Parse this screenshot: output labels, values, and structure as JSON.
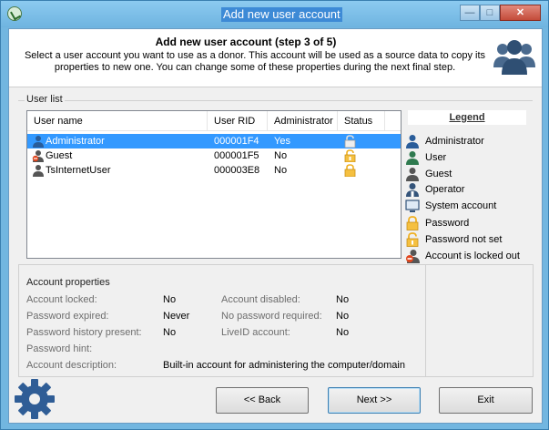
{
  "window": {
    "title": "Add new user account",
    "controls": {
      "minimize": "—",
      "maximize": "□",
      "close": "✕"
    }
  },
  "header": {
    "title": "Add new user account (step 3 of 5)",
    "description": "Select a user account you want to use as a donor. This account will be used as a source data to copy its properties to new one. You can change some of these properties during the next final step."
  },
  "user_list": {
    "group_label": "User list",
    "columns": [
      "User name",
      "User RID",
      "Administrator",
      "Status"
    ],
    "rows": [
      {
        "name": "Administrator",
        "rid": "000001F4",
        "admin": "Yes",
        "icon": "administrator-icon",
        "status_icon": "password-not-set-icon",
        "selected": true
      },
      {
        "name": "Guest",
        "rid": "000001F5",
        "admin": "No",
        "icon": "guest-locked-icon",
        "status_icon": "password-not-set-icon",
        "selected": false
      },
      {
        "name": "TsInternetUser",
        "rid": "000003E8",
        "admin": "No",
        "icon": "guest-icon",
        "status_icon": "password-icon",
        "selected": false
      }
    ]
  },
  "legend": {
    "title": "Legend",
    "items": [
      {
        "label": "Administrator",
        "icon": "administrator-icon"
      },
      {
        "label": "User",
        "icon": "user-icon"
      },
      {
        "label": "Guest",
        "icon": "guest-icon"
      },
      {
        "label": "Operator",
        "icon": "operator-icon"
      },
      {
        "label": "System account",
        "icon": "system-account-icon"
      },
      {
        "label": "Password",
        "icon": "password-icon"
      },
      {
        "label": "Password not set",
        "icon": "password-not-set-icon"
      },
      {
        "label": "Account is locked out",
        "icon": "locked-out-icon"
      }
    ]
  },
  "account_properties": {
    "group_label": "Account properties",
    "account_locked_label": "Account locked:",
    "account_locked_value": "No",
    "password_expired_label": "Password expired:",
    "password_expired_value": "Never",
    "history_label": "Password history present:",
    "history_value": "No",
    "hint_label": "Password hint:",
    "hint_value": "",
    "description_label": "Account description:",
    "description_value": "Built-in account for administering the computer/domain",
    "disabled_label": "Account disabled:",
    "disabled_value": "No",
    "no_password_label": "No password required:",
    "no_password_value": "No",
    "liveid_label": "LiveID account:",
    "liveid_value": "No"
  },
  "buttons": {
    "back": "<< Back",
    "next": "Next >>",
    "exit": "Exit"
  },
  "colors": {
    "selection": "#3399ff",
    "title_bar": "#72b6e0",
    "lock": "#f0b020"
  }
}
